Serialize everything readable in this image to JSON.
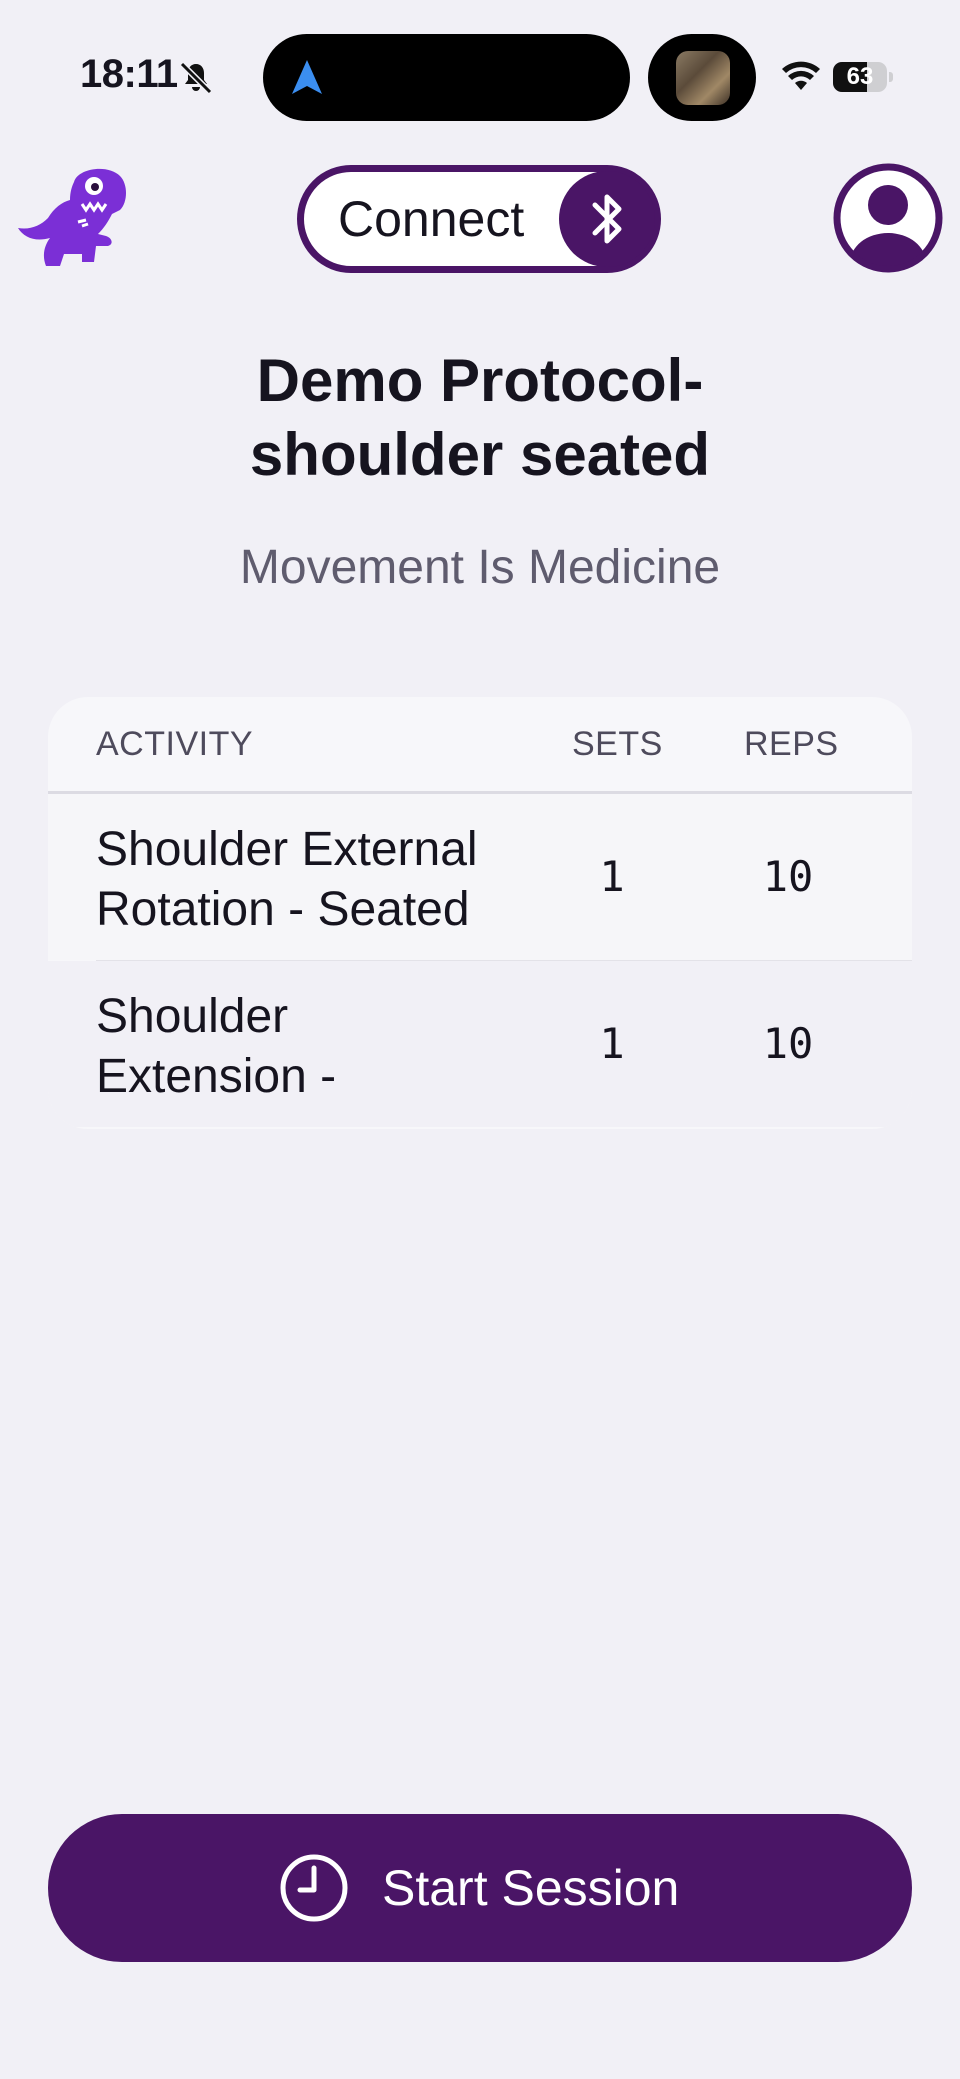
{
  "status_bar": {
    "time": "18:11",
    "battery_percent": "63",
    "battery_level": 0.63
  },
  "header": {
    "connect_label": "Connect",
    "icons": [
      "dino-logo-icon",
      "bluetooth-icon",
      "profile-avatar-icon"
    ]
  },
  "protocol": {
    "title_line1": "Demo Protocol-",
    "title_line2": "shoulder seated",
    "subtitle": "Movement Is Medicine"
  },
  "table": {
    "headers": {
      "activity": "ACTIVITY",
      "sets": "SETS",
      "reps": "REPS"
    },
    "rows": [
      {
        "activity_line1": "Shoulder External",
        "activity_line2": "Rotation - Seated",
        "sets": "1",
        "reps": "10"
      },
      {
        "activity_line1": "Shoulder",
        "activity_line2": "Extension -",
        "sets": "1",
        "reps": "10"
      }
    ]
  },
  "footer": {
    "start_label": "Start Session"
  },
  "colors": {
    "brand": "#4a1566",
    "logo": "#7b2fd6",
    "background": "#f1f0f6"
  }
}
